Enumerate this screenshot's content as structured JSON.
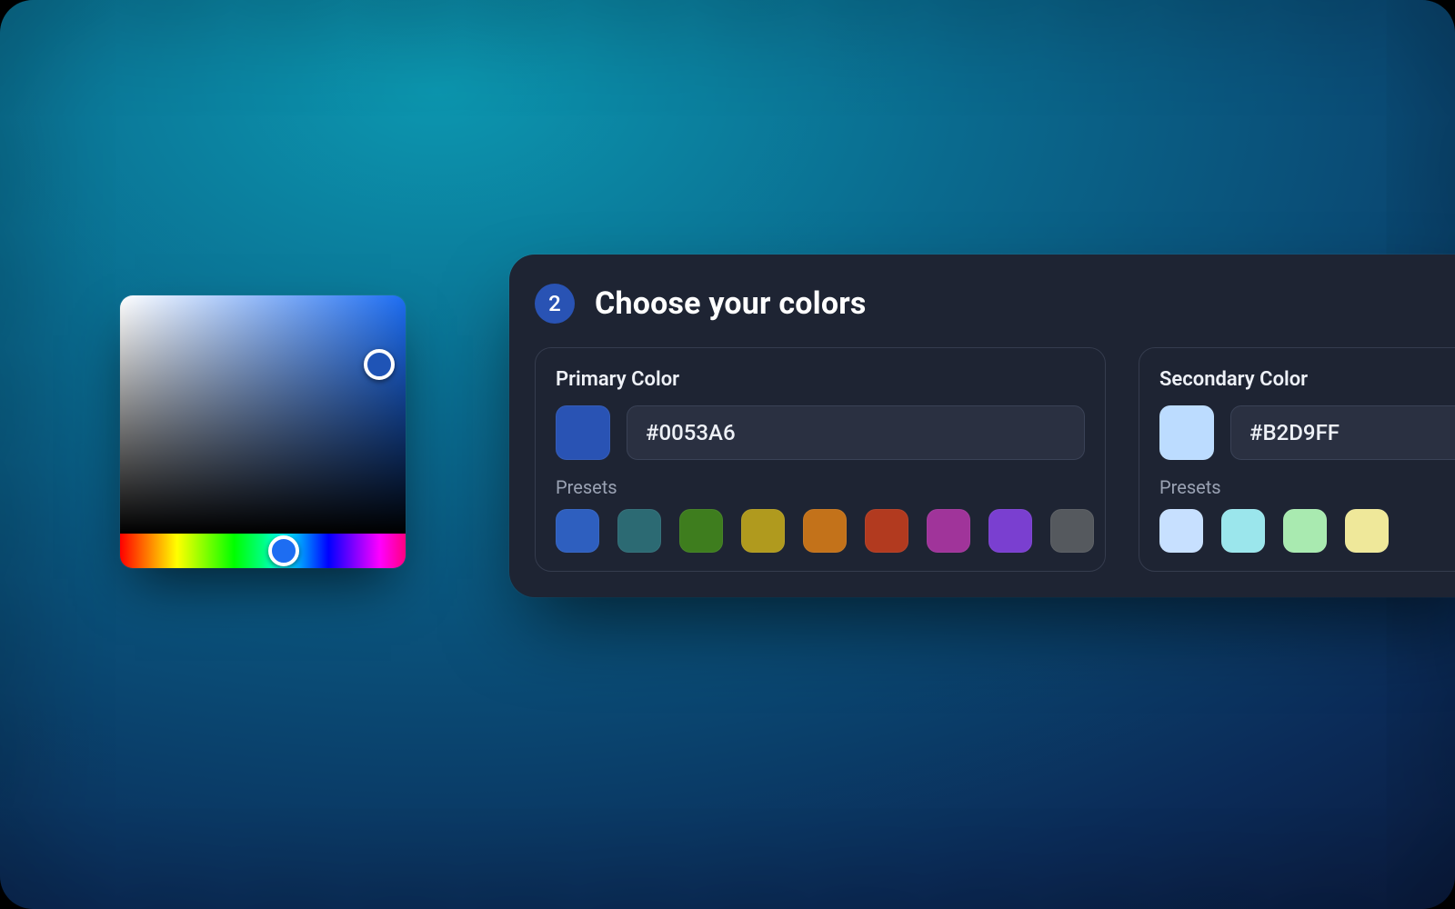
{
  "picker": {
    "selected_hue_color": "#1d6df2",
    "sv_handle_color": "#1f54b6"
  },
  "panel": {
    "step_number": "2",
    "title": "Choose your colors",
    "primary": {
      "label": "Primary Color",
      "value": "#0053A6",
      "swatch_color": "#2953b4",
      "presets_label": "Presets",
      "presets": [
        "#2e5fbf",
        "#2c6a73",
        "#3e7d1e",
        "#b09a1e",
        "#c3721a",
        "#b23a1f",
        "#a0349a",
        "#7a3fd0",
        "#55595e"
      ]
    },
    "secondary": {
      "label": "Secondary Color",
      "value": "#B2D9FF",
      "swatch_color": "#bcdcff",
      "presets_label": "Presets",
      "presets": [
        "#c7e0ff",
        "#9be6ec",
        "#a9eab0",
        "#efe89a"
      ]
    }
  }
}
